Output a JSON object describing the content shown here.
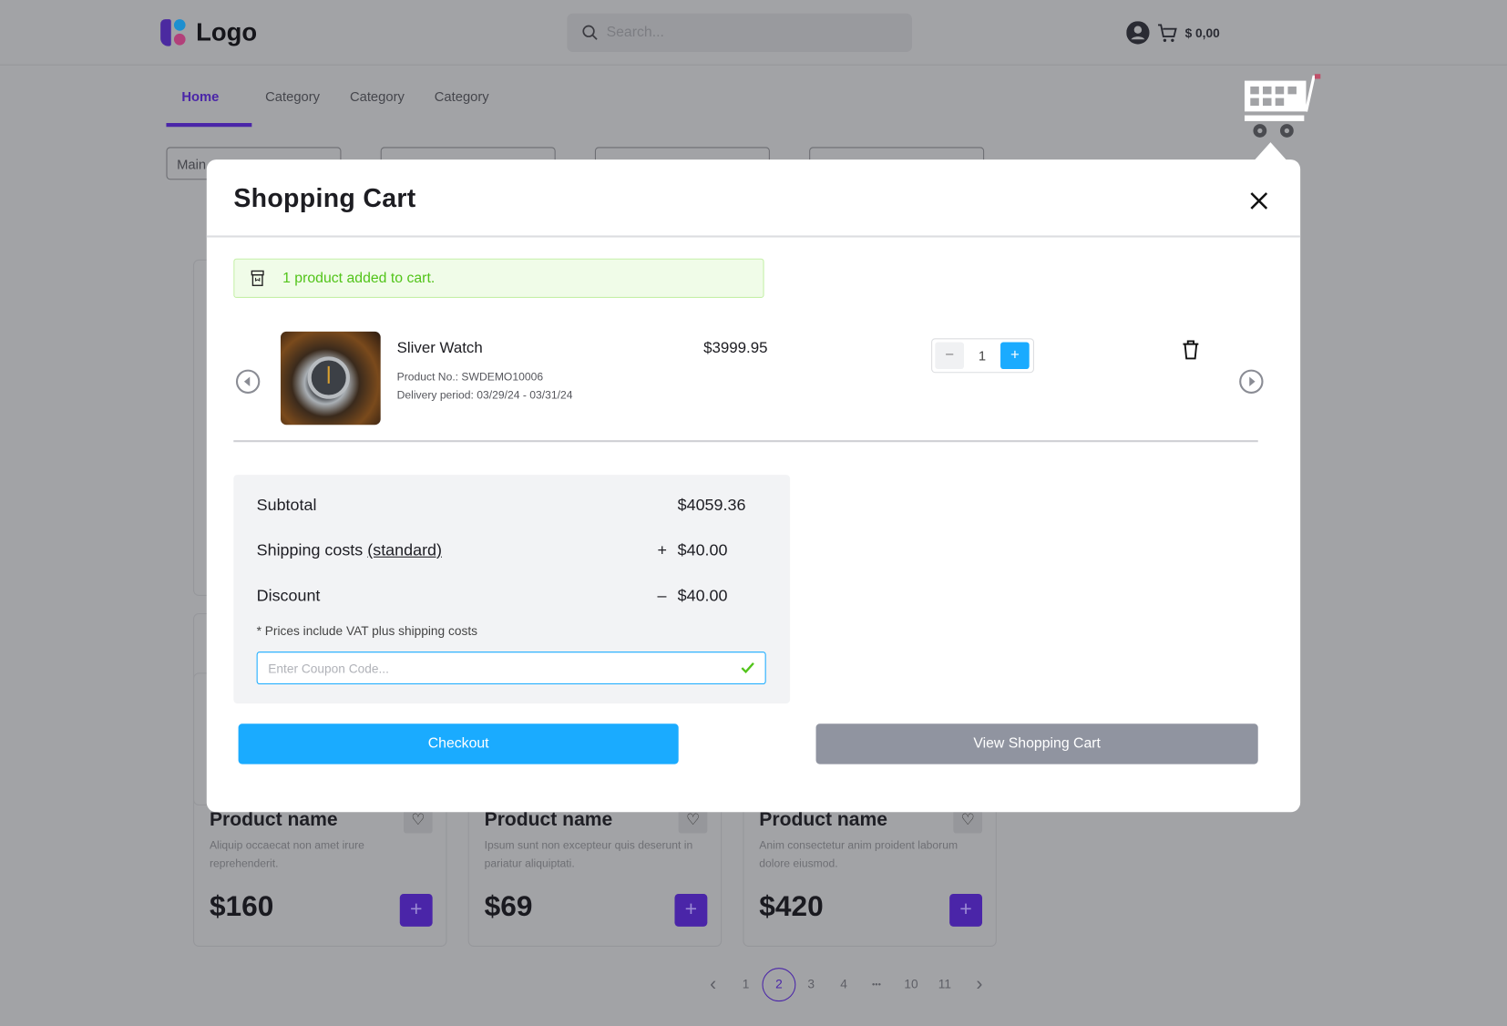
{
  "header": {
    "logo_text": "Logo",
    "search_placeholder": "Search...",
    "cart_total": "$ 0,00"
  },
  "nav": {
    "tabs": [
      {
        "label": "Home",
        "active": true
      },
      {
        "label": "Category"
      },
      {
        "label": "Category"
      },
      {
        "label": "Category"
      }
    ]
  },
  "filters": {
    "first_label": "Main"
  },
  "products": [
    {
      "name": "Product name",
      "description": "Aliquip occaecat non amet irure reprehenderit.",
      "price": "$160"
    },
    {
      "name": "Product name",
      "description": "Ipsum sunt non excepteur quis deserunt in pariatur aliquiptati.",
      "price": "$69"
    },
    {
      "name": "Product name",
      "description": "Anim consectetur anim proident laborum dolore eiusmod.",
      "price": "$420"
    }
  ],
  "pagination": {
    "prev": "‹",
    "pages": [
      "1",
      "2",
      "3",
      "4",
      "•••",
      "10",
      "11"
    ],
    "current": "2",
    "next": "›"
  },
  "cart_modal": {
    "title": "Shopping Cart",
    "alert": "1 product added to cart.",
    "item": {
      "name": "Sliver Watch",
      "product_no": "Product No.: SWDEMO10006",
      "delivery": "Delivery period: 03/29/24 - 03/31/24",
      "price": "$3999.95",
      "quantity": "1"
    },
    "summary": {
      "subtotal_label": "Subtotal",
      "subtotal": "$4059.36",
      "shipping_label": "Shipping costs",
      "shipping_type": "(standard)",
      "shipping_sign": "+",
      "shipping": "$40.00",
      "discount_label": "Discount",
      "discount_sign": "–",
      "discount": "$40.00",
      "note": "* Prices include VAT plus shipping costs",
      "coupon_placeholder": "Enter Coupon Code..."
    },
    "checkout_label": "Checkout",
    "view_cart_label": "View Shopping Cart"
  },
  "colors": {
    "accent": "#1aabff",
    "brand": "#4a25a8",
    "success": "#52c41a",
    "secondary_button": "#9094a0"
  }
}
